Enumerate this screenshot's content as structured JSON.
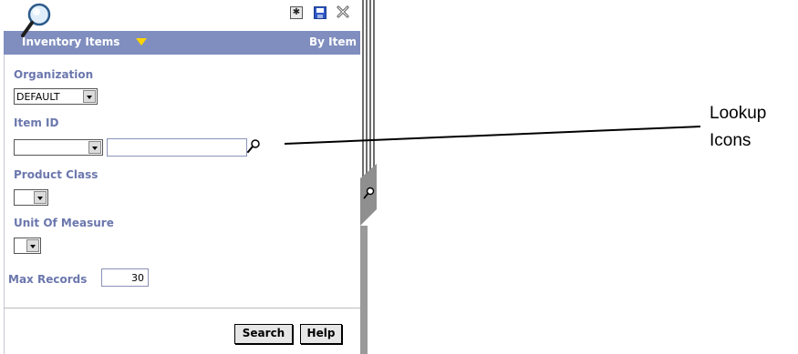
{
  "header": {
    "title": "Inventory Items",
    "mode": "By Item"
  },
  "toolbar": {
    "icons": [
      "search-magnifier-icon",
      "new-icon",
      "save-icon",
      "close-icon"
    ]
  },
  "form": {
    "organization": {
      "label": "Organization",
      "value": "DEFAULT"
    },
    "item_id": {
      "label": "Item ID",
      "qualifier_value": "",
      "text_value": ""
    },
    "product_class": {
      "label": "Product Class",
      "value": ""
    },
    "unit_of_measure": {
      "label": "Unit Of Measure",
      "value": ""
    },
    "max_records": {
      "label": "Max Records",
      "value": "30"
    }
  },
  "buttons": {
    "search": "Search",
    "help": "Help"
  },
  "callout": {
    "line1": "Lookup",
    "line2": "Icons"
  },
  "colors": {
    "title_bar": "#7f8ebe",
    "label": "#6b77ad",
    "accent": "#ffd400"
  }
}
